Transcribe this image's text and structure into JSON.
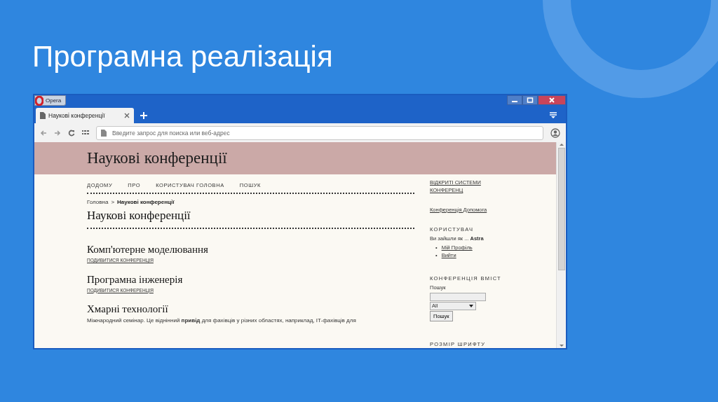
{
  "slide": {
    "title": "Програмна реалізація"
  },
  "browser": {
    "app_button": "Opera",
    "tabs": [
      {
        "label": "Наукові конференції",
        "selected": true
      }
    ],
    "address": {
      "placeholder": "Введите запрос для поиска или веб-адрес"
    }
  },
  "page": {
    "site_title": "Наукові конференції",
    "nav": [
      "ДОДОМУ",
      "ПРО",
      "КОРИСТУВАЧ ГОЛОВНА",
      "ПОШУК"
    ],
    "breadcrumb": [
      {
        "label": "Головна",
        "current": false
      },
      {
        "label": "Наукові конференції",
        "current": true
      }
    ],
    "breadcrumb_separator": ">",
    "heading": "Наукові конференції",
    "conferences": [
      {
        "title": "Комп'ютерне моделювання",
        "link": "ПОДИВИТИСЯ КОНФЕРЕНЦІЯ"
      },
      {
        "title": "Програмна інженерія",
        "link": "ПОДИВИТИСЯ КОНФЕРЕНЦІЯ"
      },
      {
        "title": "Хмарні технології",
        "description": "Міжнародний семінар. Це віднінний **привід** для фахівців у різних областях, наприклад, IT-фахівців для"
      }
    ],
    "sidebar": {
      "links": [
        "ВІДКРИТІ СИСТЕМИ КОНФЕРЕНЦ",
        "Конференція Допомога"
      ],
      "user": {
        "heading": "КОРИСТУВАЧ",
        "logged_in_as": "Ви зайшли як ... **Astra**",
        "links": [
          {
            "bullet": "•",
            "label": "Мій Профіль"
          },
          {
            "bullet": "•",
            "label": "Вийти"
          }
        ]
      },
      "content": {
        "heading": "КОНФЕРЕНЦІЯ ВМІСТ",
        "search_label": "Пошук",
        "scope": "All",
        "button": "Пошук"
      },
      "font_size": {
        "heading": "РОЗМІР ШРИФТУ"
      }
    }
  }
}
